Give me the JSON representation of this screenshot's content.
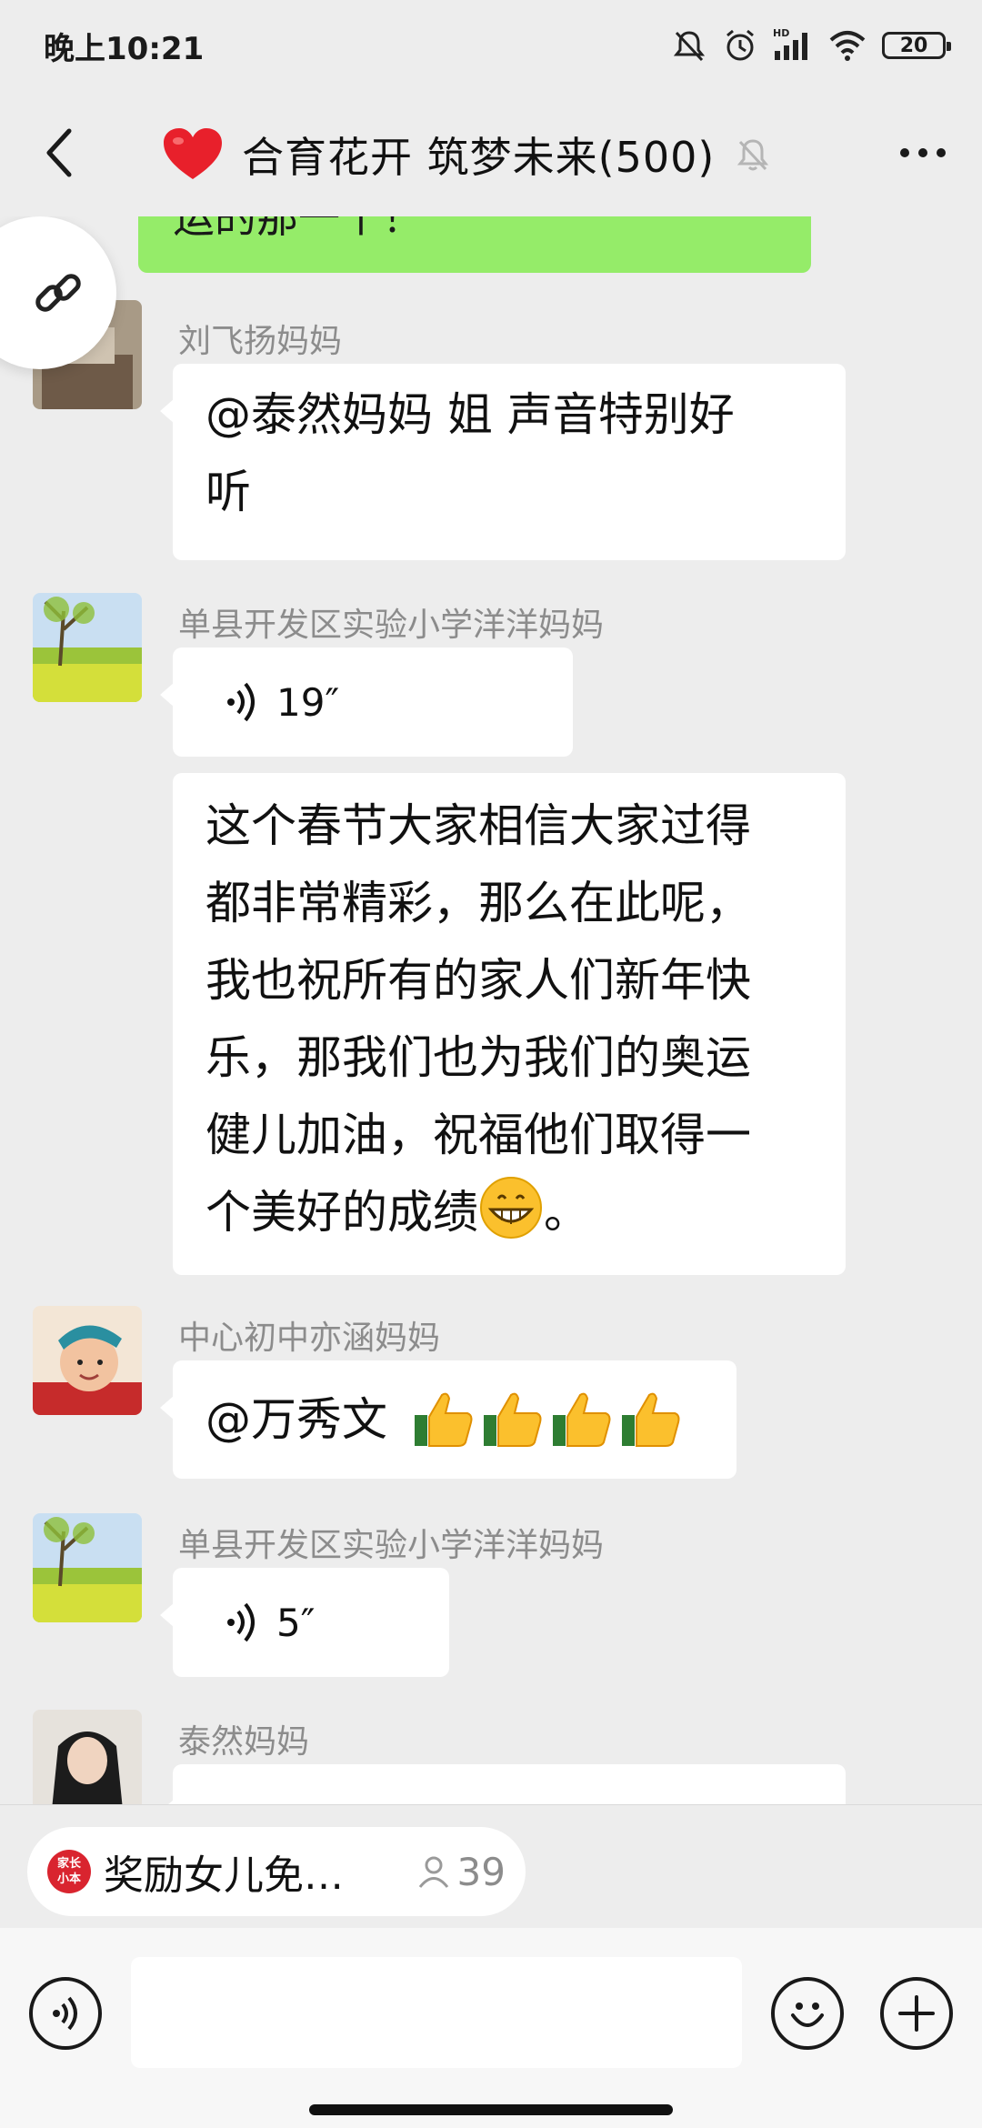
{
  "status_bar": {
    "time": "晚上10:21",
    "network_label": "HD",
    "battery": "20"
  },
  "header": {
    "title": "合育花开 筑梦未来(500)",
    "icons": [
      "back-icon",
      "heart-emoji-icon",
      "mute-bell-icon",
      "more-icon"
    ]
  },
  "messages": {
    "partial_own_text": "运的那一个！",
    "m1": {
      "sender": "刘飞扬妈妈",
      "line1": "@泰然妈妈  姐  声音特别好",
      "line2": "听"
    },
    "m2": {
      "sender": "单县开发区实验小学洋洋妈妈",
      "voice_duration": "19″",
      "text_lines": [
        "这个春节大家相信大家过得",
        "都非常精彩，那么在此呢，",
        "我也祝所有的家人们新年快",
        "乐，那我们也为我们的奥运",
        "健儿加油，祝福他们取得一",
        "个美好的成绩"
      ],
      "text_end": "。"
    },
    "m3": {
      "sender": "中心初中亦涵妈妈",
      "text": "@万秀文"
    },
    "m4": {
      "sender": "单县开发区实验小学洋洋妈妈",
      "voice_duration": "5″"
    },
    "m5": {
      "sender": "泰然妈妈"
    }
  },
  "pinned": {
    "logo_text_1": "家长",
    "logo_text_2": "小本",
    "title": "奖励女儿免…",
    "count": "39"
  },
  "input": {
    "placeholder": ""
  },
  "colors": {
    "background": "#ededed",
    "own_bubble": "#95ec69",
    "other_bubble": "#ffffff",
    "sender_name": "#8c8c8c"
  }
}
